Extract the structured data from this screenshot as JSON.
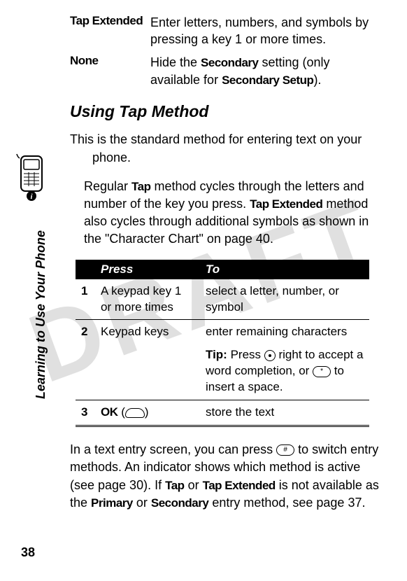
{
  "watermark": "DRAFT",
  "definitions": [
    {
      "term": "Tap Extended",
      "desc_prefix": "Enter letters, numbers, and symbols by pressing a key 1 or more times."
    },
    {
      "term": "None",
      "desc_parts": [
        "Hide the ",
        "Secondary",
        " setting (only available for ",
        "Secondary Setup",
        ")."
      ]
    }
  ],
  "heading": "Using Tap Method",
  "para1": "This is the standard method for entering text on your phone.",
  "para2_parts": [
    "Regular ",
    "Tap",
    " method cycles through the letters and number of the key you press. ",
    "Tap Extended",
    " method also cycles through additional symbols as shown in the \"Character Chart\" on page 40."
  ],
  "side_label": "Learning to Use Your Phone",
  "table": {
    "headers": {
      "press": "Press",
      "to": "To"
    },
    "rows": [
      {
        "num": "1",
        "press": "A keypad key 1 or more times",
        "to": "select a letter, number, or symbol"
      },
      {
        "num": "2",
        "press": "Keypad keys",
        "to_line1": "enter remaining characters",
        "tip_label": "Tip:",
        "tip_text1": " Press ",
        "tip_text2": " right to accept a word completion, or ",
        "tip_text3": " to insert a space."
      },
      {
        "num": "3",
        "press_bold": "OK",
        "press_rest": " (",
        "press_end": ")",
        "to": "store the text"
      }
    ]
  },
  "para3_parts": [
    "In a text entry screen, you can press ",
    " to switch entry methods. An indicator shows which method is active (see page 30). If ",
    "Tap",
    " or ",
    "Tap Extended",
    " is not available as the ",
    "Primary",
    " or ",
    "Secondary",
    " entry method, see page 37."
  ],
  "key_star": "*",
  "key_hash": "#",
  "page_number": "38"
}
